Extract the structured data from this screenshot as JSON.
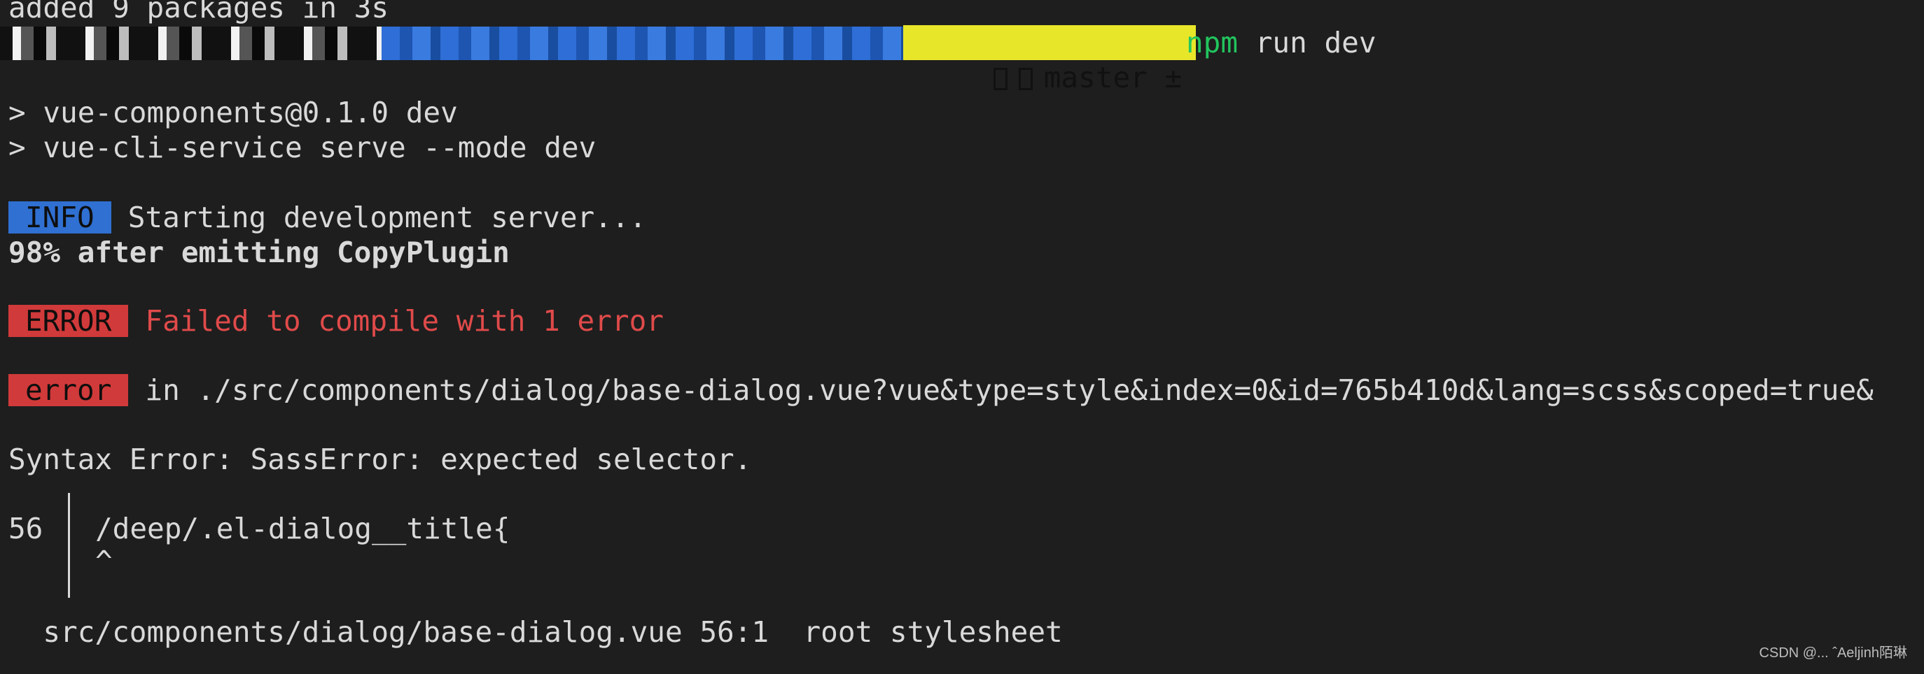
{
  "terminal": {
    "line_added": "added 9 packages in 3s",
    "git_branch": "master ±",
    "cmd_npm": "npm",
    "cmd_rest": " run dev",
    "script_line1": "> vue-components@0.1.0 dev",
    "script_line2": "> vue-cli-service serve --mode dev",
    "info_badge": "INFO",
    "info_text": "Starting development server...",
    "progress_text": "98% after emitting CopyPlugin",
    "error_badge": "ERROR",
    "error_text": "Failed to compile with 1 error",
    "error_badge_lower": "error",
    "error_location": "in ./src/components/dialog/base-dialog.vue?vue&type=style&index=0&id=765b410d&lang=scss&scoped=true&",
    "syntax_error": "Syntax Error: SassError: expected selector.",
    "code_line_number": "56",
    "code_line": "/deep/.el-dialog__title{",
    "code_caret": "^",
    "stack_line": "  src/components/dialog/base-dialog.vue 56:1  root stylesheet"
  },
  "watermark": "CSDN @... ˆAeljinh陌琳",
  "colors": {
    "background": "#1e1e1e",
    "info_badge": "#2f70d2",
    "error_badge": "#d13a3a",
    "error_text": "#e04a4a",
    "git_segment": "#e8e629",
    "npm": "#22c55e"
  }
}
